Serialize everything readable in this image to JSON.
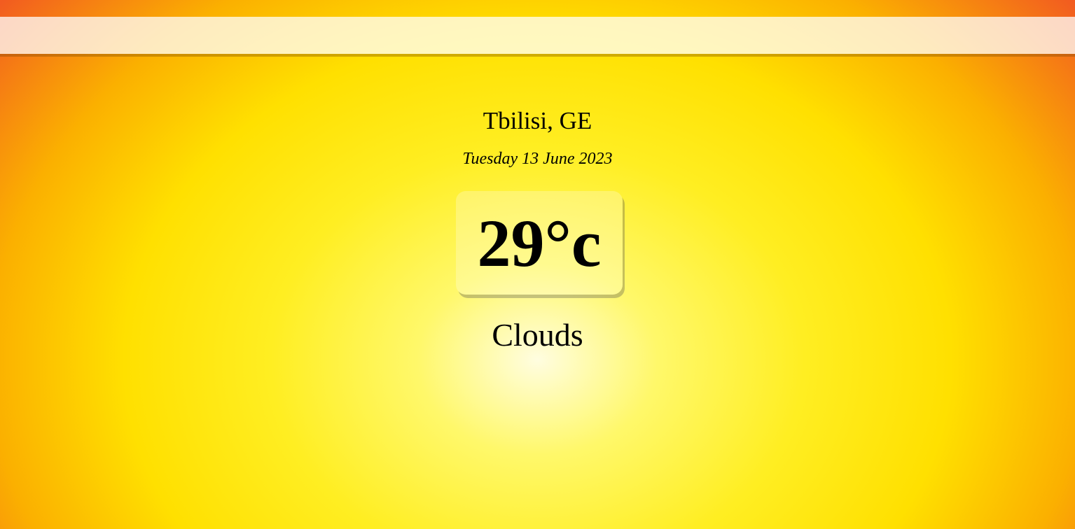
{
  "search": {
    "value": "",
    "placeholder": ""
  },
  "location": "Tbilisi, GE",
  "date": "Tuesday 13 June 2023",
  "temperature": "29°c",
  "condition": "Clouds"
}
